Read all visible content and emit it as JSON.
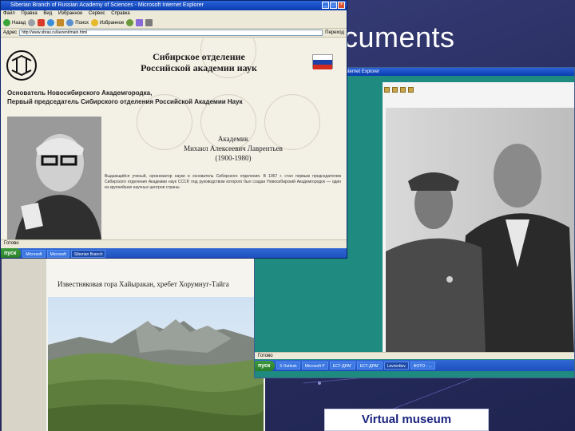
{
  "slide": {
    "title_fragment": "cuments",
    "label": "Virtual museum"
  },
  "window_main": {
    "title": "Siberian Branch of Russian Academy of Sciences - Microsoft Internet Explorer",
    "menu": [
      "Файл",
      "Правка",
      "Вид",
      "Избранное",
      "Сервис",
      "Справка"
    ],
    "toolbar": {
      "back": "Назад",
      "search": "Поиск",
      "favorites": "Избранное"
    },
    "address_label": "Адрес",
    "address": "http://www.sbras.ru/lavrent/main.html",
    "go": "Переход",
    "org_line1": "Сибирское отделение",
    "org_line2": "Российской академии наук",
    "founder_line1": "Основатель Новосибирского Академгородка,",
    "founder_line2": "Первый председатель Сибирского отделения Российской Академии Наук",
    "acad_title": "Академик",
    "acad_name": "Михаил Алексеевич Лаврентьев",
    "acad_years": "(1900-1980)",
    "bio": "Выдающийся ученый, организатор науки и основатель Сибирского отделения. В 1957 г. стал первым председателем Сибирского отделения Академии наук СССР, под руководством которого был создан Новосибирский Академгородок — один из крупнейших научных центров страны.",
    "status": "Готово",
    "start": "пуск",
    "tasks": [
      "Microsoft",
      "Microsoft",
      "Siberian Branch"
    ],
    "tasks_active_index": 2
  },
  "window_photo": {
    "title": "Лаврентьев и космонавт - Microsoft Internet Explorer",
    "status": "Готово",
    "start": "пуск",
    "tasks": [
      "5 Outlook",
      "Microsoft P",
      "ЕСТ-ДРАГ",
      "ЕСТ-ДРАГ",
      "Lavrentiev",
      "ФОТО - ..."
    ]
  },
  "window_landscape": {
    "caption": "Известняковая гора Хайыракан, хребет Хорумнуг-Тайга"
  },
  "colors": {
    "background": "#2e3466",
    "label_text": "#1a237e",
    "teal": "#1f8a80"
  }
}
